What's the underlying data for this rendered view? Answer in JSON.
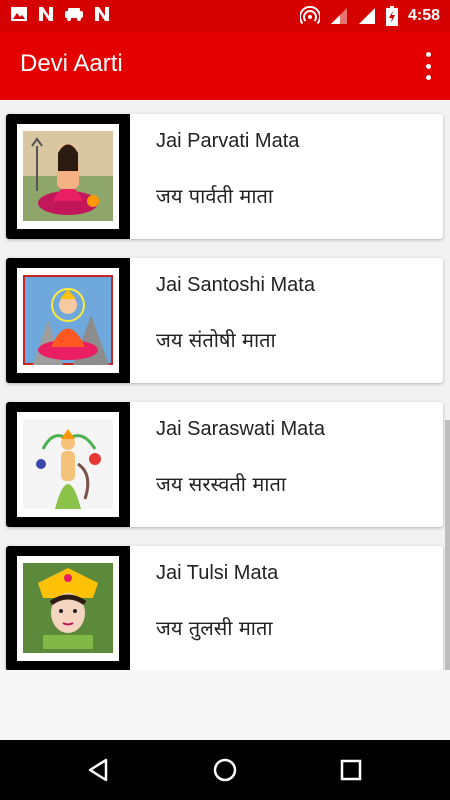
{
  "status_bar": {
    "time": "4:58",
    "left_icons": [
      "image-icon",
      "n-notification-icon",
      "car-icon",
      "n-notification-icon"
    ],
    "right_icons": [
      "hotspot-icon",
      "signal-icon",
      "signal-icon",
      "battery-charging-icon"
    ],
    "color": "#d50000"
  },
  "app_bar": {
    "title": "Devi Aarti",
    "color": "#e50000",
    "menu_icon": "overflow-menu-icon"
  },
  "items": [
    {
      "title_en": "Jai Parvati Mata",
      "title_hi": "जय पार्वती माता"
    },
    {
      "title_en": "Jai Santoshi Mata",
      "title_hi": "जय संतोषी माता"
    },
    {
      "title_en": "Jai Saraswati Mata",
      "title_hi": "जय सरस्वती माता"
    },
    {
      "title_en": "Jai Tulsi Mata",
      "title_hi": "जय तुलसी माता"
    }
  ],
  "nav_bar": {
    "buttons": [
      "back-icon",
      "home-icon",
      "recents-icon"
    ]
  }
}
